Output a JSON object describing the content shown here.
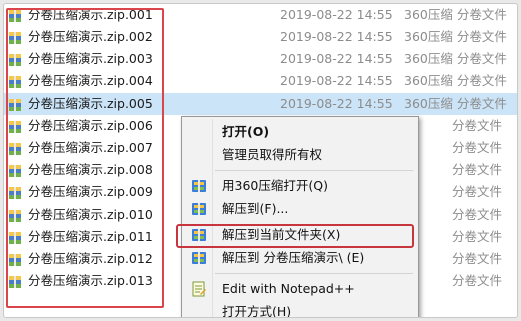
{
  "files": [
    {
      "name": "分卷压缩演示.zip.001",
      "date": "2019-08-22 14:55",
      "type": "360压缩 分卷文件"
    },
    {
      "name": "分卷压缩演示.zip.002",
      "date": "2019-08-22 14:55",
      "type": "360压缩 分卷文件"
    },
    {
      "name": "分卷压缩演示.zip.003",
      "date": "2019-08-22 14:55",
      "type": "360压缩 分卷文件"
    },
    {
      "name": "分卷压缩演示.zip.004",
      "date": "2019-08-22 14:55",
      "type": "360压缩 分卷文件"
    },
    {
      "name": "分卷压缩演示.zip.005",
      "date": "2019-08-22 14:55",
      "type": "360压缩 分卷文件"
    },
    {
      "name": "分卷压缩演示.zip.006",
      "date": "",
      "type": "分卷文件"
    },
    {
      "name": "分卷压缩演示.zip.007",
      "date": "",
      "type": "分卷文件"
    },
    {
      "name": "分卷压缩演示.zip.008",
      "date": "",
      "type": "分卷文件"
    },
    {
      "name": "分卷压缩演示.zip.009",
      "date": "",
      "type": "分卷文件"
    },
    {
      "name": "分卷压缩演示.zip.010",
      "date": "",
      "type": "分卷文件"
    },
    {
      "name": "分卷压缩演示.zip.011",
      "date": "",
      "type": "分卷文件"
    },
    {
      "name": "分卷压缩演示.zip.012",
      "date": "",
      "type": "分卷文件"
    },
    {
      "name": "分卷压缩演示.zip.013",
      "date": "",
      "type": "分卷文件"
    }
  ],
  "selected_index": 4,
  "context_menu": {
    "open": "打开(O)",
    "admin_ownership": "管理员取得所有权",
    "open_with_360": "用360压缩打开(Q)",
    "extract_to": "解压到(F)...",
    "extract_here": "解压到当前文件夹(X)",
    "extract_to_folder": "解压到 分卷压缩演示\\ (E)",
    "edit_notepad": "Edit with Notepad++",
    "open_method": "打开方式(H)"
  },
  "colors": {
    "highlight_red": "#c7363d",
    "selection_blue": "#cce4f7"
  },
  "icons": {
    "file": "archive-volume-icon",
    "zip_menu": "360-zip-icon",
    "notepad": "notepad-plus-plus-icon"
  }
}
